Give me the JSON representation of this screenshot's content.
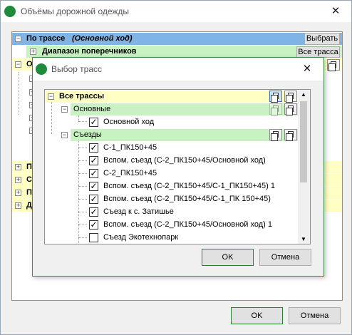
{
  "window": {
    "title": "Объёмы дорожной одежды",
    "ok_label": "OK",
    "cancel_label": "Отмена"
  },
  "tree": {
    "route_label": "По трассе",
    "route_sub": "(Основной ход)",
    "select_label": "Выбрать",
    "range_label": "Диапазон поперечников",
    "all_routes_label": "Все трасса",
    "collapsed_prefix": "О",
    "left_letters": [
      "П",
      "С",
      "П",
      "Д"
    ]
  },
  "dialog": {
    "title": "Выбор трасс",
    "root": "Все трассы",
    "group_main": "Основные",
    "item_main": "Основной ход",
    "group_exits": "Съезды",
    "items": [
      {
        "label": "С-1_ПК150+45",
        "checked": true
      },
      {
        "label": "Вспом. съезд (С-2_ПК150+45/Основной ход)",
        "checked": true
      },
      {
        "label": "С-2_ПК150+45",
        "checked": true
      },
      {
        "label": "Вспом. съезд (С-2_ПК150+45/С-1_ПК150+45) 1",
        "checked": true
      },
      {
        "label": "Вспом. съезд (С-2_ПК150+45/С-1_ПК 150+45)",
        "checked": true
      },
      {
        "label": "Съезд к с. Затишье",
        "checked": true
      },
      {
        "label": "Вспом. съезд (С-2_ПК150+45/Основной ход) 1",
        "checked": true
      },
      {
        "label": "Съезд Экотехнопарк",
        "checked": false
      }
    ],
    "ok_label": "OK",
    "cancel_label": "Отмена"
  },
  "colors": {
    "header_blue": "#7fb5e6",
    "row_green": "#c9f2c2",
    "row_yellow": "#ffffc4",
    "accent_green": "#1e8a3c"
  }
}
